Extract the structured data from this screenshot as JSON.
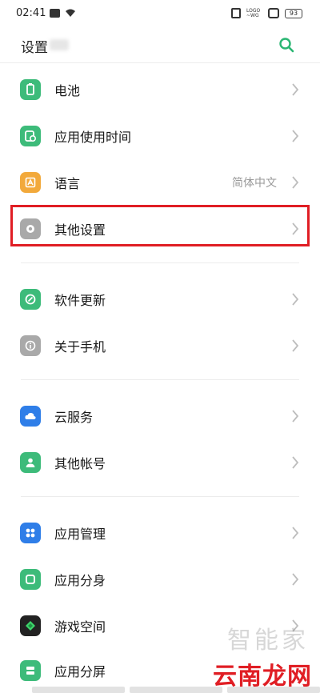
{
  "status_bar": {
    "time": "02:41",
    "logo_text": "LOGO ~WG",
    "battery": "93"
  },
  "header": {
    "title": "设置",
    "search_icon": "search-icon"
  },
  "groups": [
    {
      "items": [
        {
          "label": "电池",
          "icon": "battery-icon",
          "icon_color": "#3dbb7a"
        },
        {
          "label": "应用使用时间",
          "icon": "app-usage-time-icon",
          "icon_color": "#3dbb7a"
        },
        {
          "label": "语言",
          "icon": "language-icon",
          "icon_color": "#f2a93b",
          "value": "简体中文"
        },
        {
          "label": "其他设置",
          "icon": "other-settings-icon",
          "icon_color": "#a9a9a9"
        }
      ]
    },
    {
      "items": [
        {
          "label": "软件更新",
          "icon": "software-update-icon",
          "icon_color": "#3dbb7a"
        },
        {
          "label": "关于手机",
          "icon": "about-phone-icon",
          "icon_color": "#a9a9a9"
        }
      ]
    },
    {
      "items": [
        {
          "label": "云服务",
          "icon": "cloud-service-icon",
          "icon_color": "#2f7ee8"
        },
        {
          "label": "其他帐号",
          "icon": "other-accounts-icon",
          "icon_color": "#3dbb7a"
        }
      ]
    },
    {
      "items": [
        {
          "label": "应用管理",
          "icon": "app-management-icon",
          "icon_color": "#2f7ee8"
        },
        {
          "label": "应用分身",
          "icon": "app-clone-icon",
          "icon_color": "#3dbb7a"
        },
        {
          "label": "游戏空间",
          "icon": "game-space-icon",
          "icon_color": "#222222"
        },
        {
          "label": "应用分屏",
          "icon": "split-screen-icon",
          "icon_color": "#3dbb7a"
        }
      ]
    }
  ],
  "watermark_top": "智能家",
  "watermark": "云南龙网",
  "colors": {
    "accent": "#2bb673",
    "highlight": "#e01e24"
  }
}
